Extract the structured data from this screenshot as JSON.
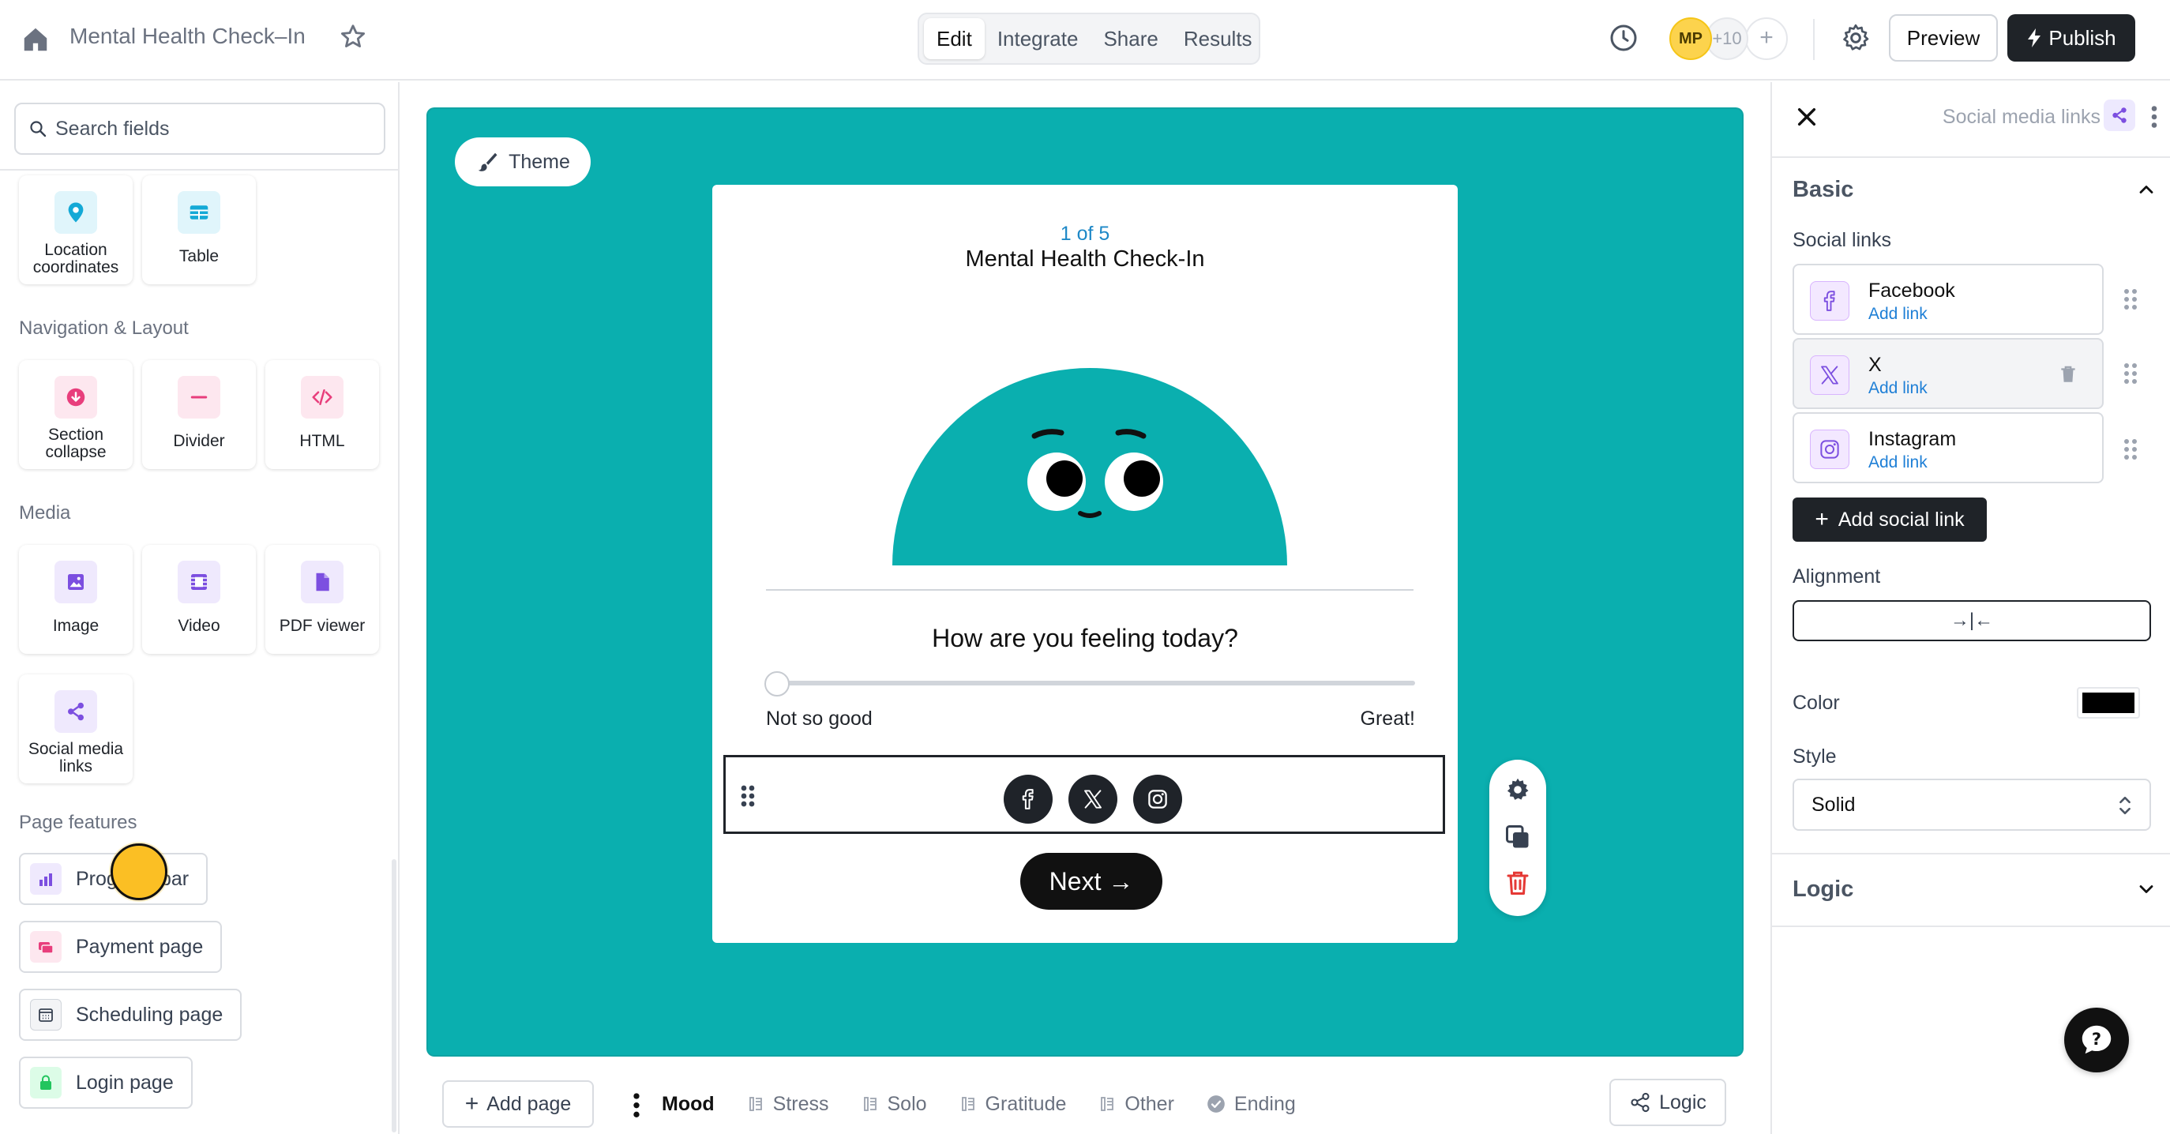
{
  "topbar": {
    "title": "Mental Health Check–In",
    "tabs": [
      "Edit",
      "Integrate",
      "Share",
      "Results"
    ],
    "active_tab": "Edit",
    "avatar_initials": "MP",
    "avatar_more": "+10",
    "preview_label": "Preview",
    "publish_label": "Publish"
  },
  "sidebar": {
    "search_placeholder": "Search fields",
    "top_tiles": [
      {
        "label": "Location coordinates",
        "icon": "location-pin-icon"
      },
      {
        "label": "Table",
        "icon": "table-icon"
      }
    ],
    "sections": [
      {
        "title": "Navigation & Layout",
        "tiles": [
          {
            "label": "Section collapse",
            "icon": "section-collapse-icon"
          },
          {
            "label": "Divider",
            "icon": "divider-icon"
          },
          {
            "label": "HTML",
            "icon": "code-icon"
          }
        ]
      },
      {
        "title": "Media",
        "tiles": [
          {
            "label": "Image",
            "icon": "image-icon"
          },
          {
            "label": "Video",
            "icon": "video-icon"
          },
          {
            "label": "PDF viewer",
            "icon": "pdf-icon"
          },
          {
            "label": "Social media links",
            "icon": "share-icon"
          }
        ]
      }
    ],
    "page_features_title": "Page features",
    "page_features": [
      {
        "label": "Progress bar",
        "icon": "bar-chart-icon"
      },
      {
        "label": "Payment page",
        "icon": "payment-icon"
      },
      {
        "label": "Scheduling page",
        "icon": "calendar-icon"
      },
      {
        "label": "Login page",
        "icon": "lock-icon"
      }
    ]
  },
  "canvas": {
    "theme_label": "Theme",
    "page_counter": "1 of 5",
    "form_title": "Mental Health Check-In",
    "question": "How are you feeling today?",
    "slider_min_label": "Not so good",
    "slider_max_label": "Great!",
    "slider_value": 0,
    "next_label": "Next →",
    "background_color": "#0aafaf"
  },
  "pagebar": {
    "add_page_label": "Add page",
    "pages": [
      {
        "label": "Mood",
        "active": true
      },
      {
        "label": "Stress",
        "active": false
      },
      {
        "label": "Solo",
        "active": false
      },
      {
        "label": "Gratitude",
        "active": false
      },
      {
        "label": "Other",
        "active": false
      },
      {
        "label": "Ending",
        "active": false
      }
    ],
    "logic_label": "Logic"
  },
  "right_panel": {
    "title": "Social media links",
    "basic_title": "Basic",
    "social_links_label": "Social links",
    "links": [
      {
        "name": "Facebook",
        "action": "Add link",
        "icon": "facebook-icon"
      },
      {
        "name": "X",
        "action": "Add link",
        "icon": "x-icon"
      },
      {
        "name": "Instagram",
        "action": "Add link",
        "icon": "instagram-icon"
      }
    ],
    "add_social_label": "Add social link",
    "alignment_label": "Alignment",
    "alignment_value": "→|←",
    "color_label": "Color",
    "color_value": "#000000",
    "style_label": "Style",
    "style_value": "Solid",
    "logic_title": "Logic"
  }
}
